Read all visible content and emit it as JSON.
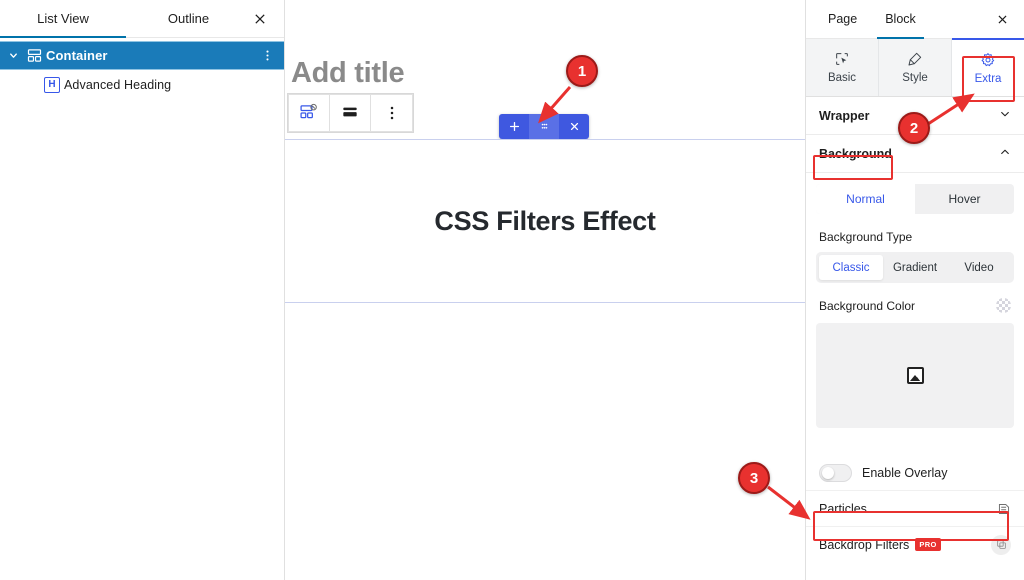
{
  "list_view": {
    "tabs": [
      {
        "label": "List View",
        "active": true
      },
      {
        "label": "Outline",
        "active": false
      }
    ],
    "close_label": "×",
    "rows": [
      {
        "label": "Container",
        "icon": "container-icon",
        "selected": true
      },
      {
        "label": "Advanced Heading",
        "icon": "heading-h-icon",
        "selected": false
      }
    ],
    "heading_icon_letter": "H"
  },
  "canvas": {
    "title_placeholder": "Add title",
    "block_toolbar": [
      {
        "name": "container-block-icon"
      },
      {
        "name": "align-icon"
      },
      {
        "name": "more-options-icon"
      }
    ],
    "float_toolbar": [
      {
        "name": "add-block-icon",
        "glyph": "+"
      },
      {
        "name": "drag-handle-icon",
        "glyph": "⠿"
      },
      {
        "name": "remove-block-icon",
        "glyph": "×"
      }
    ],
    "heading_text": "CSS Filters Effect"
  },
  "settings": {
    "top_tabs": [
      {
        "label": "Page",
        "active": false
      },
      {
        "label": "Block",
        "active": true
      }
    ],
    "close_label": "×",
    "section_tabs": [
      {
        "label": "Basic",
        "icon": "cursor-select-icon",
        "active": false
      },
      {
        "label": "Style",
        "icon": "paint-brush-icon",
        "active": false
      },
      {
        "label": "Extra",
        "icon": "gear-icon",
        "active": true
      }
    ],
    "wrapper": {
      "label": "Wrapper",
      "expanded": false
    },
    "background": {
      "label": "Background",
      "expanded": true
    },
    "state_tabs": [
      {
        "label": "Normal",
        "active": true
      },
      {
        "label": "Hover",
        "active": false
      }
    ],
    "background_type": {
      "label": "Background Type",
      "options": [
        {
          "label": "Classic",
          "active": true
        },
        {
          "label": "Gradient",
          "active": false
        },
        {
          "label": "Video",
          "active": false
        }
      ]
    },
    "background_color": {
      "label": "Background Color",
      "reset_icon": "checker-swatch-icon",
      "image_placeholder_icon": "broken-image-icon"
    },
    "enable_overlay": {
      "label": "Enable Overlay",
      "enabled": false
    },
    "rows": [
      {
        "label": "Particles",
        "icon": "particles-icon",
        "badge": null,
        "highlighted": true
      },
      {
        "label": "Backdrop Filters",
        "icon": "backdrop-filters-icon",
        "badge": "PRO",
        "highlighted": false
      }
    ]
  },
  "annotations": {
    "accent_color": "#e8312f",
    "markers": [
      {
        "number": "1",
        "target": "float-toolbar-drag-handle"
      },
      {
        "number": "2",
        "target": "extra-tab"
      },
      {
        "number": "3",
        "target": "particles-row"
      }
    ],
    "highlight_boxes": [
      {
        "target": "extra-tab"
      },
      {
        "target": "background-section"
      },
      {
        "target": "particles-row"
      }
    ]
  }
}
